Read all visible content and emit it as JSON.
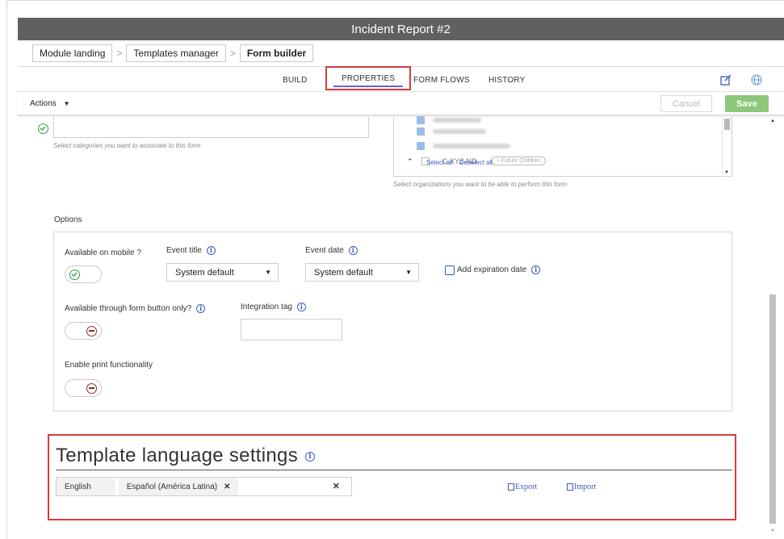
{
  "window": {
    "title": "Incident Report #2"
  },
  "breadcrumb": [
    "Module landing",
    "Templates manager",
    "Form builder"
  ],
  "tabs": [
    {
      "label": "BUILD"
    },
    {
      "label": "PROPERTIES",
      "active": true
    },
    {
      "label": "FORM FLOWS"
    },
    {
      "label": "HISTORY"
    }
  ],
  "toolbar": {
    "actions_label": "Actions",
    "cancel_label": "Cancel",
    "save_label": "Save"
  },
  "categories": {
    "helper": "Select categories you want to associate to this form"
  },
  "organizations": {
    "visible_item": "C-XYZ-ND",
    "future_children": "+ Future Children",
    "select_all": "Select all",
    "deselect_all": "Deselect all",
    "helper": "Select organizations you want to be able to perform this form"
  },
  "options": {
    "title": "Options",
    "available_on_mobile": {
      "label": "Available on mobile ?",
      "enabled": true
    },
    "event_title": {
      "label": "Event title",
      "value": "System default"
    },
    "event_date": {
      "label": "Event date",
      "value": "System default"
    },
    "expiration": {
      "label": "Add expiration date",
      "checked": false
    },
    "form_button_only": {
      "label": "Available through form button only?",
      "enabled": false
    },
    "integration_tag": {
      "label": "Integration tag",
      "value": ""
    },
    "print": {
      "label": "Enable print functionality",
      "enabled": false
    }
  },
  "language_settings": {
    "title": "Template language settings",
    "default_language": "English",
    "languages": [
      "Español (América Latina)"
    ],
    "export_label": "Export",
    "import_label": "Import"
  },
  "colors": {
    "accent": "#3b5bbf",
    "save": "#8dc77b",
    "highlight": "#d63c3c",
    "titlebar": "#5e615f"
  }
}
